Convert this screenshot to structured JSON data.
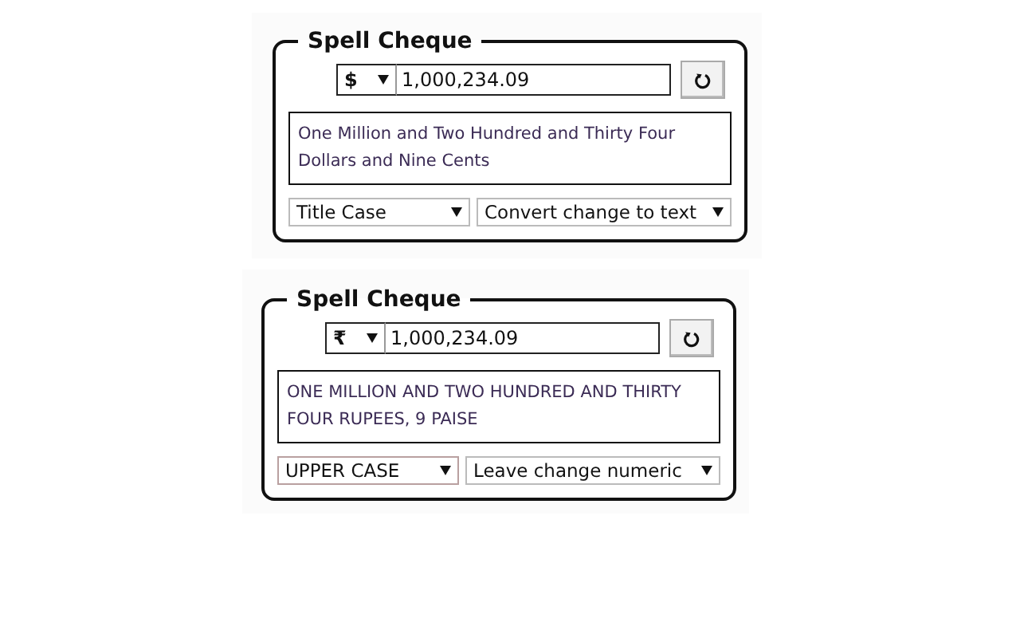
{
  "panels": [
    {
      "title": "Spell Cheque",
      "currency": "$",
      "amount": "1,000,234.09",
      "words": "One Million and Two Hundred and Thirty Four Dollars and Nine Cents",
      "case_option": "Title Case",
      "change_option": "Convert change to text"
    },
    {
      "title": "Spell Cheque",
      "currency": "₹",
      "amount": "1,000,234.09",
      "words": "ONE MILLION AND TWO HUNDRED AND THIRTY FOUR RUPEES, 9 PAISE",
      "case_option": "UPPER CASE",
      "change_option": "Leave change numeric"
    }
  ]
}
